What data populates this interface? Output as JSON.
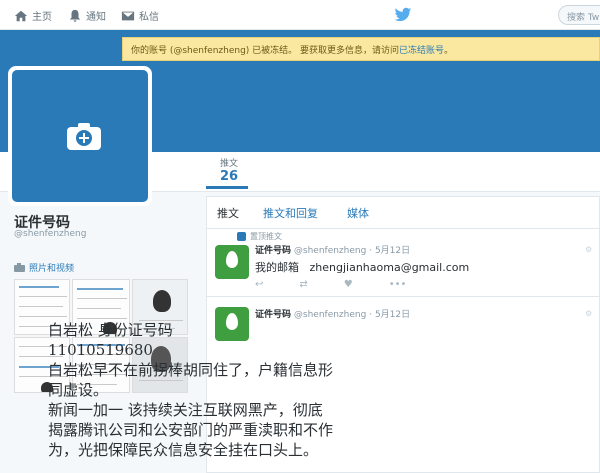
{
  "nav": {
    "home_label": "主页",
    "notifications_label": "通知",
    "messages_label": "私信",
    "search_placeholder": "搜索 Twitter"
  },
  "notice": {
    "text": "你的账号 (@shenfenzheng) 已被冻结。 要获取更多信息，请访问",
    "link": "已冻结账号",
    "suffix": "。"
  },
  "profile": {
    "tweets_label": "推文",
    "tweets_count": "26",
    "name": "证件号码",
    "handle": "@shenfenzheng",
    "photos_label": "照片和视频"
  },
  "tabs": [
    "推文",
    "推文和回复",
    "媒体"
  ],
  "tweets": [
    {
      "pinned_label": "置顶推文",
      "name": "证件号码",
      "handle": "@shenfenzheng",
      "date": "5月12日",
      "text_label": "我的邮箱",
      "text_email": "zhengjianhaoma@gmail.com"
    },
    {
      "name": "证件号码",
      "handle": "@shenfenzheng",
      "date": "5月12日",
      "lines": [
        "白岩松  身份证号码",
        "11010519680",
        "白岩松早不在前拐棒胡同住了，户籍信息形",
        "同虚设。",
        "新闻一加一  该持续关注互联网黑产，彻底",
        "揭露腾讯公司和公安部门的严重渎职和不作",
        "为，光把保障民众信息安全挂在口头上。"
      ]
    }
  ],
  "colors": {
    "brand": "#2a7ab8",
    "link": "#2b7bb9",
    "notice_bg": "#fbe8a0",
    "egg_green": "#3f9e3f"
  }
}
